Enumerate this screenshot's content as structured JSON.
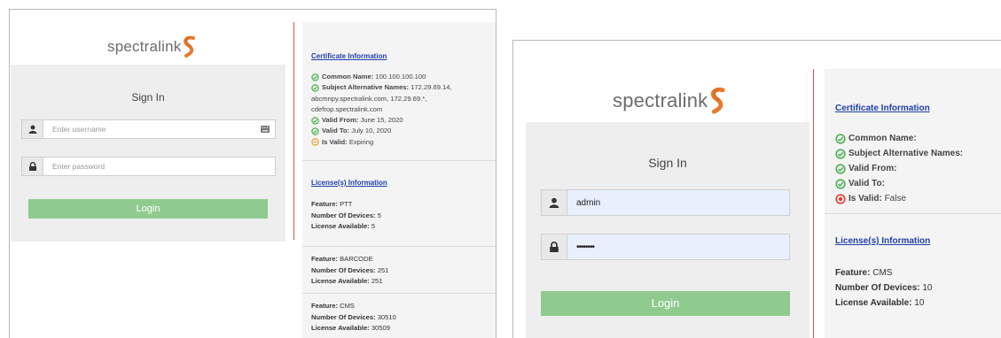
{
  "brand": {
    "name": "spectralink",
    "accent": "#e97a2b",
    "accent2": "#d96c25"
  },
  "colors": {
    "login_button": "#8fcb8e",
    "divider": "#d9534f",
    "link": "#1f3fa8",
    "ok": "#4caf50",
    "warn": "#f0a030",
    "error": "#e53935"
  },
  "left": {
    "signin": {
      "title": "Sign In",
      "username_placeholder": "Enter username",
      "password_placeholder": "Enter password",
      "login_label": "Login"
    },
    "certificate": {
      "heading": "Certificate Information",
      "lines": [
        {
          "status": "ok",
          "label": "Common Name:",
          "value": "100.100.100.100"
        },
        {
          "status": "ok",
          "label": "Subject Alternative Names:",
          "value": "172.29.69.14,"
        },
        {
          "status": "none",
          "label": "",
          "value": "abcmnpy.spectralink.com, 172.29.69.*,"
        },
        {
          "status": "none",
          "label": "",
          "value": "cdefrop.spectralink.com"
        },
        {
          "status": "ok",
          "label": "Valid From:",
          "value": "June 15, 2020"
        },
        {
          "status": "ok",
          "label": "Valid To:",
          "value": "July 10, 2020"
        },
        {
          "status": "warn",
          "label": "Is Valid:",
          "value": "Expiring"
        }
      ]
    },
    "licenses": {
      "heading": "License(s) Information",
      "groups": [
        {
          "feature_label": "Feature:",
          "feature": "PTT",
          "devices_label": "Number Of Devices:",
          "devices": "5",
          "available_label": "License Available:",
          "available": "5"
        },
        {
          "feature_label": "Feature:",
          "feature": "BARCODE",
          "devices_label": "Number Of Devices:",
          "devices": "251",
          "available_label": "License Available:",
          "available": "251"
        },
        {
          "feature_label": "Feature:",
          "feature": "CMS",
          "devices_label": "Number Of Devices:",
          "devices": "30510",
          "available_label": "License Available:",
          "available": "30509"
        }
      ]
    }
  },
  "right": {
    "signin": {
      "title": "Sign In",
      "username_value": "admin",
      "password_value": "••••••••",
      "login_label": "Login"
    },
    "certificate": {
      "heading": "Certificate Information",
      "lines": [
        {
          "status": "ok",
          "label": "Common Name:",
          "value": ""
        },
        {
          "status": "ok",
          "label": "Subject Alternative Names:",
          "value": ""
        },
        {
          "status": "ok",
          "label": "Valid From:",
          "value": ""
        },
        {
          "status": "ok",
          "label": "Valid To:",
          "value": ""
        },
        {
          "status": "error",
          "label": "Is Valid:",
          "value": "False"
        }
      ]
    },
    "licenses": {
      "heading": "License(s) Information",
      "groups": [
        {
          "feature_label": "Feature:",
          "feature": "CMS",
          "devices_label": "Number Of Devices:",
          "devices": "10",
          "available_label": "License Available:",
          "available": "10"
        }
      ]
    }
  }
}
